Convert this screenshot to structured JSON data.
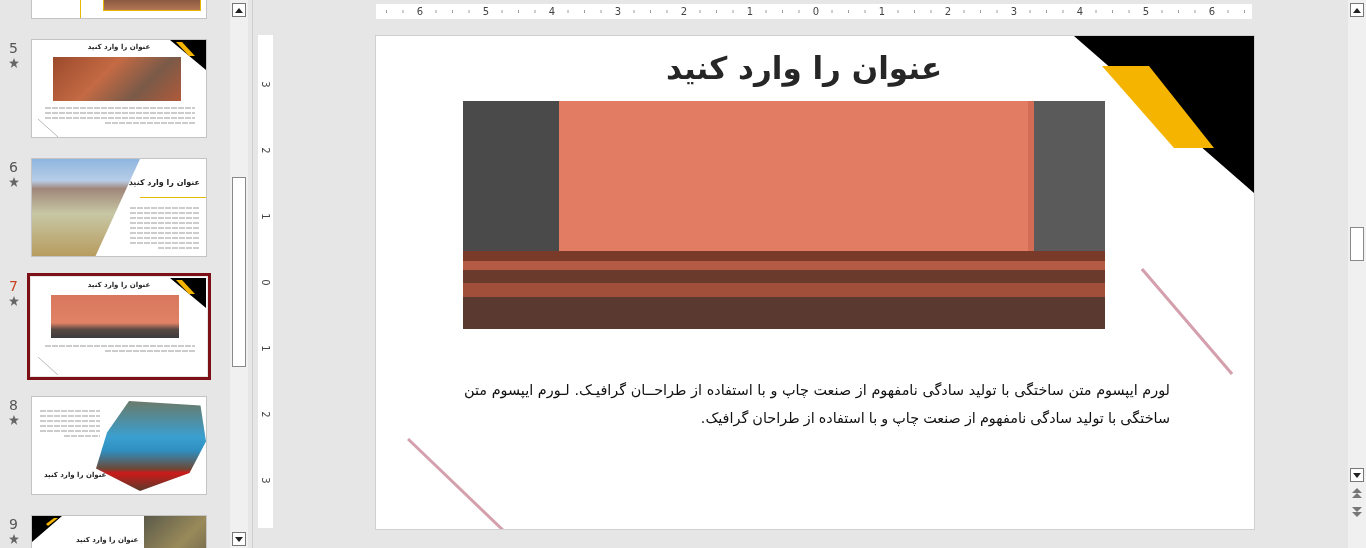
{
  "slide_panel": {
    "slides": [
      {
        "kind": "partial",
        "selected": false
      },
      {
        "kind": "image-top",
        "number": "5",
        "animated": true,
        "selected": false,
        "title": "عنوان را وارد کنید"
      },
      {
        "kind": "image-left",
        "number": "6",
        "animated": true,
        "selected": false,
        "title": "عنوان را وارد کنید"
      },
      {
        "kind": "image-top",
        "number": "7",
        "animated": true,
        "selected": true,
        "title": "عنوان را وارد کنید"
      },
      {
        "kind": "image-right",
        "number": "8",
        "animated": true,
        "selected": false,
        "title": "عنوان را وارد کنید"
      },
      {
        "kind": "split",
        "number": "9",
        "animated": true,
        "selected": false,
        "title": "عنوان را وارد کنید"
      }
    ]
  },
  "horizontal_ruler": {
    "labels": [
      "6",
      "5",
      "4",
      "3",
      "2",
      "1",
      "0",
      "1",
      "2",
      "3",
      "4",
      "5",
      "6"
    ]
  },
  "vertical_ruler": {
    "labels": [
      "3",
      "2",
      "1",
      "0",
      "1",
      "2",
      "3"
    ]
  },
  "slide": {
    "title": "عنوان را وارد کنید",
    "body": "لورم ایپسوم متن ساختگی با تولید سادگی نامفهوم از صنعت چاپ و با استفاده از طراحــان گرافیـک. لـورم ایپسوم متن ساختگی با تولید سادگی نامفهوم از صنعت چاپ و با استفاده از طراحان گرافیک."
  }
}
